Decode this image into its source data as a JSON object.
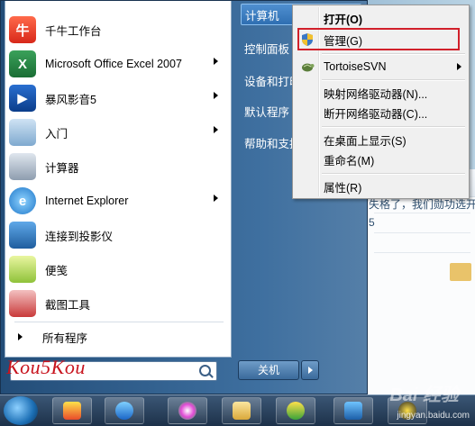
{
  "left_menu": {
    "items": [
      {
        "label": "千牛工作台",
        "icon": "qianniu-icon",
        "has_submenu": false
      },
      {
        "label": "Microsoft Office Excel 2007",
        "icon": "excel-icon",
        "has_submenu": true
      },
      {
        "label": "暴风影音5",
        "icon": "baofeng-icon",
        "has_submenu": true
      },
      {
        "label": "入门",
        "icon": "getting-started-icon",
        "has_submenu": true
      },
      {
        "label": "计算器",
        "icon": "calculator-icon",
        "has_submenu": false
      },
      {
        "label": "Internet Explorer",
        "icon": "ie-icon",
        "has_submenu": true
      },
      {
        "label": "连接到投影仪",
        "icon": "projector-icon",
        "has_submenu": false
      },
      {
        "label": "便笺",
        "icon": "sticky-notes-icon",
        "has_submenu": false
      },
      {
        "label": "截图工具",
        "icon": "snipping-tool-icon",
        "has_submenu": false
      }
    ],
    "all_programs": "所有程序",
    "watermark": "Kou5Kou"
  },
  "right_menu": {
    "items": [
      "计算机",
      "控制面板",
      "设备和打印",
      "默认程序",
      "帮助和支持"
    ],
    "shutdown": "关机"
  },
  "context_menu": {
    "items": [
      {
        "label": "打开(O)",
        "bold": true
      },
      {
        "label": "管理(G)",
        "icon": "shield-icon"
      },
      {
        "label": "TortoiseSVN",
        "icon": "tortoise-icon",
        "has_submenu": true
      },
      {
        "label": "映射网络驱动器(N)..."
      },
      {
        "label": "断开网络驱动器(C)..."
      },
      {
        "label": "在桌面上显示(S)"
      },
      {
        "label": "重命名(M)"
      },
      {
        "label": "属性(R)"
      }
    ]
  },
  "background_window": {
    "text1": "失格了，我们勋功选开启",
    "text2": "5"
  },
  "watermarks": {
    "baidu": "Bai 经验",
    "site": "jingyan.baidu.com"
  }
}
